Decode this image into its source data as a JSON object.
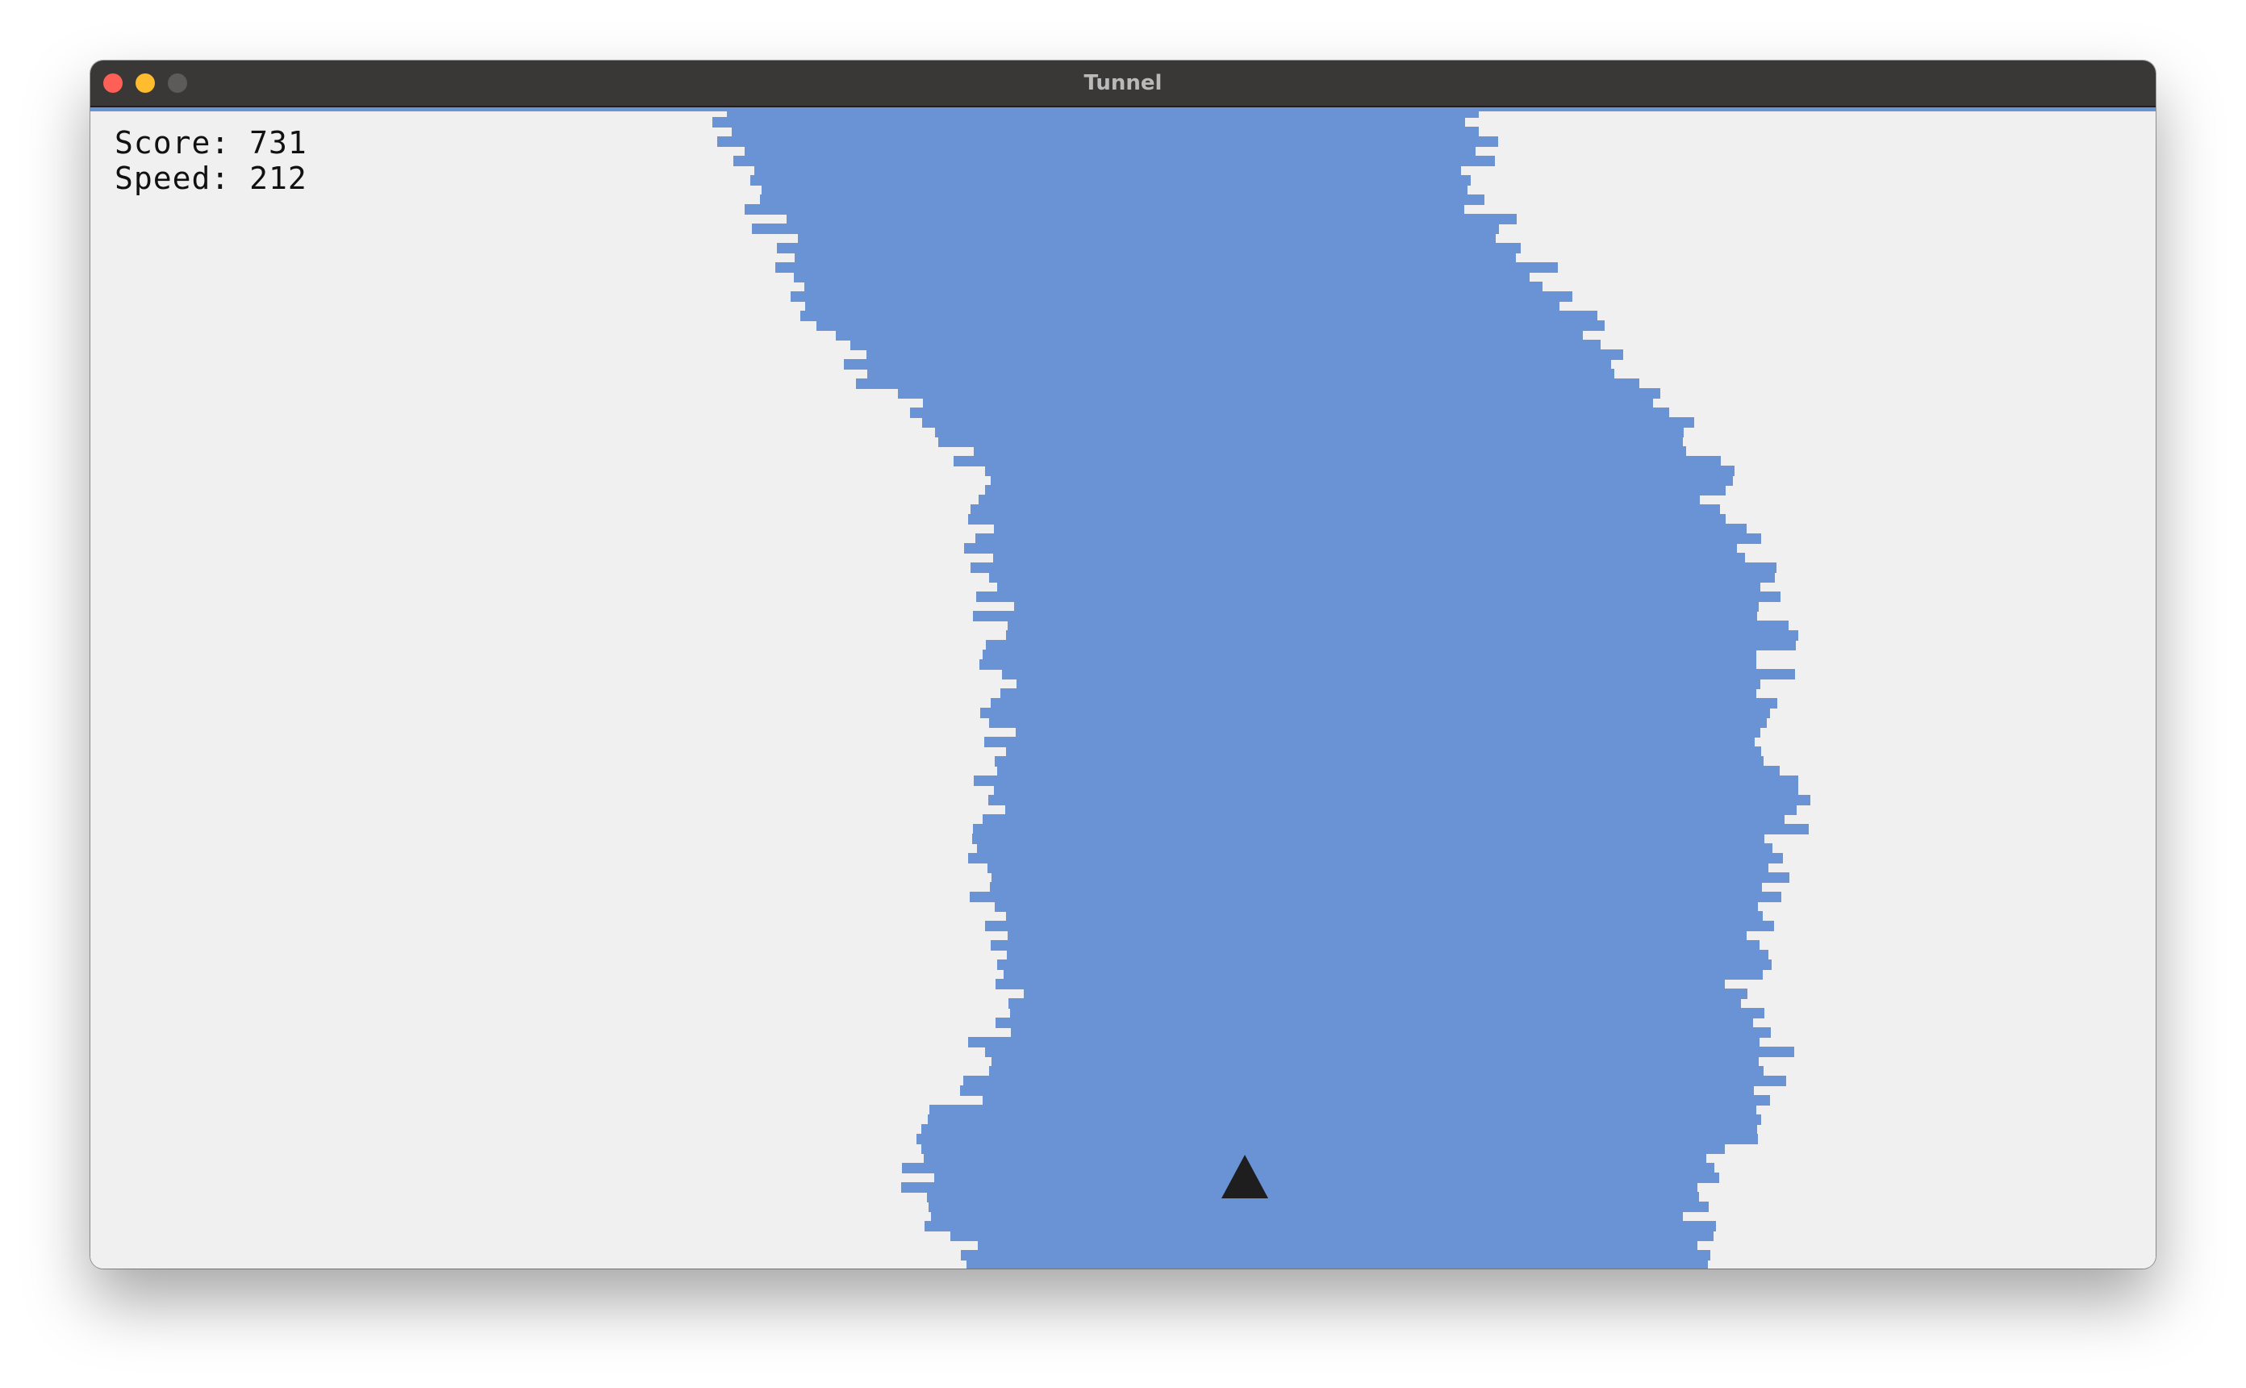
{
  "window": {
    "title": "Tunnel"
  },
  "hud": {
    "score_label": "Score: ",
    "score_value": "731",
    "speed_label": "Speed: ",
    "speed_value": "212"
  },
  "colors": {
    "background": "#f0f0f0",
    "tunnel": "#6a93d6",
    "player": "#1e1e1e"
  },
  "icons": {
    "player": "triangle-ship-icon"
  }
}
